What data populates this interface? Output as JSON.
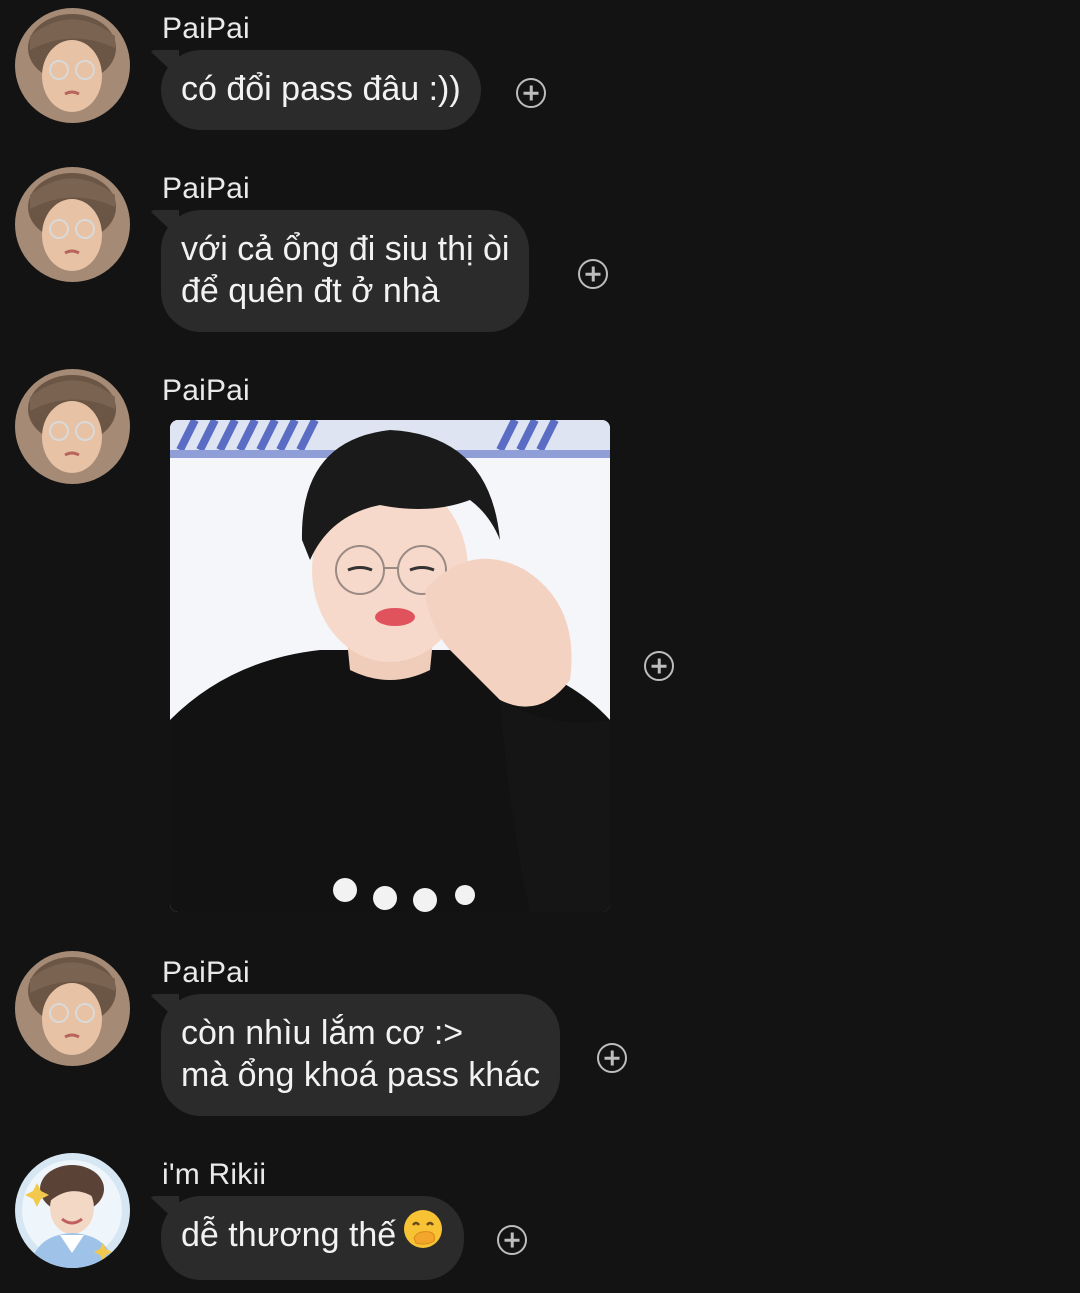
{
  "messages": [
    {
      "sender": "PaiPai",
      "lines": [
        "có đổi pass đâu :))"
      ]
    },
    {
      "sender": "PaiPai",
      "lines": [
        "với cả ổng đi siu thị òi",
        "để quên đt ở nhà"
      ]
    },
    {
      "sender": "PaiPai",
      "image": "sleepy-boy-glasses-photo"
    },
    {
      "sender": "PaiPai",
      "lines": [
        "còn nhìu lắm cơ :>",
        "mà ổng khoá pass khác"
      ]
    },
    {
      "sender": "i'm Rikii",
      "lines": [
        "dễ thương thế"
      ],
      "emoji": "hand-over-mouth-emoji"
    }
  ],
  "icons": {
    "react": "add-reaction-icon"
  },
  "colors": {
    "background": "#131313",
    "bubble": "#2b2b2b",
    "text": "#f2f2f2",
    "icon": "#bdbdbd"
  }
}
